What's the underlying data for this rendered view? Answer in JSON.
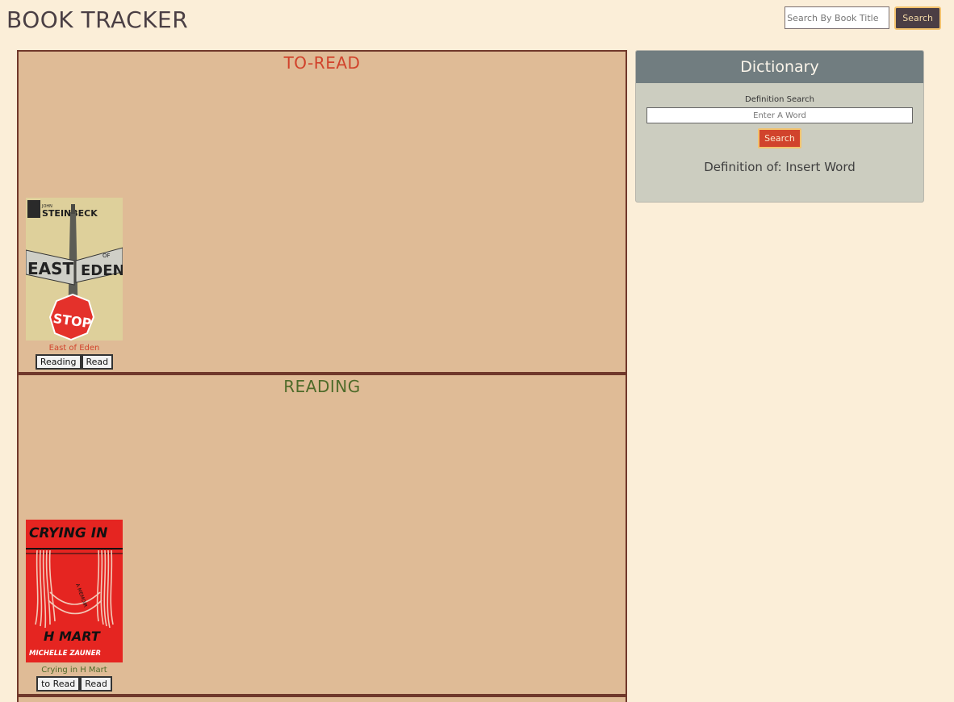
{
  "header": {
    "title": "BOOK TRACKER",
    "search_placeholder": "Search By Book Title",
    "search_button": "Search"
  },
  "shelves": [
    {
      "title": "TO-READ",
      "book": {
        "title": "East of Eden",
        "cover_text": [
          "STEINBECK",
          "EAST",
          "OF",
          "EDEN",
          "STOP"
        ],
        "buttons": [
          "Reading",
          "Read"
        ]
      }
    },
    {
      "title": "READING",
      "book": {
        "title": "Crying in H Mart",
        "cover_text": [
          "CRYING IN",
          "H MART",
          "MICHELLE ZAUNER",
          "A MEMOIR"
        ],
        "buttons": [
          "to Read",
          "Read"
        ]
      }
    }
  ],
  "dictionary": {
    "title": "Dictionary",
    "label": "Definition Search",
    "input_placeholder": "Enter A Word",
    "button": "Search",
    "result": "Definition of: Insert Word"
  },
  "colors": {
    "background": "#fbeed8",
    "shelf": "#dfbb96",
    "shelf_border": "#70382b",
    "accent_red": "#d1432c",
    "accent_green": "#4e6b2a",
    "dictionary_header": "#717d80"
  }
}
